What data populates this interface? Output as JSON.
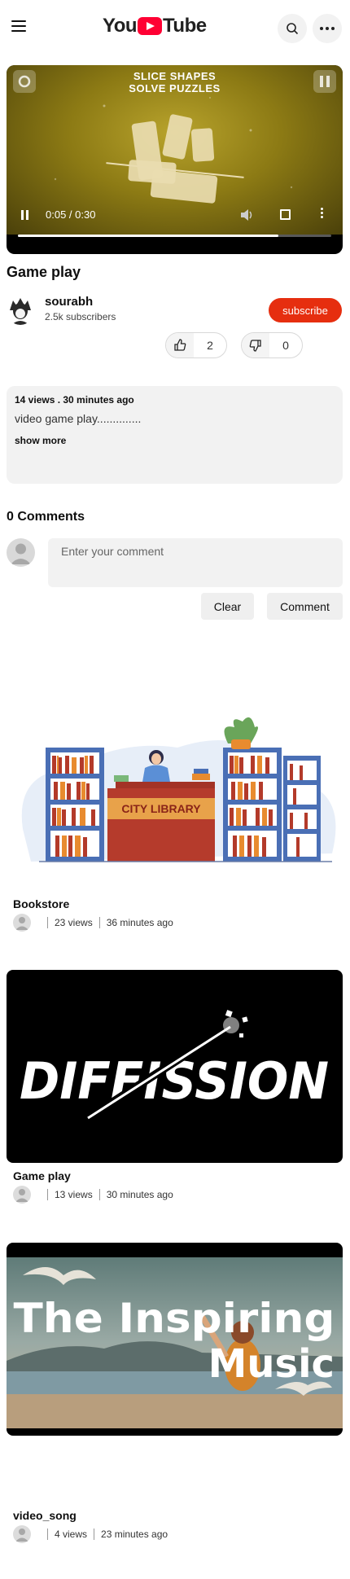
{
  "header": {
    "logo_left": "You",
    "logo_right": "Tube"
  },
  "player": {
    "game_title_line1": "SLICE SHAPES",
    "game_title_line2": "SOLVE PUZZLES",
    "time": "0:05 / 0:30",
    "progress_fraction": 0.83
  },
  "video": {
    "title": "Game play",
    "channel_name": "sourabh",
    "subscribers": "2.5k subscribers",
    "subscribe_label": "subscribe",
    "likes": "2",
    "dislikes": "0"
  },
  "description": {
    "meta": "14 views . 30 minutes ago",
    "text": "video game play..............",
    "show_more": "show more"
  },
  "comments": {
    "heading": "0 Comments",
    "placeholder": "Enter your comment",
    "clear_label": "Clear",
    "comment_label": "Comment"
  },
  "related": [
    {
      "title": "Bookstore",
      "views": "23 views",
      "time": "36 minutes ago",
      "thumb_text": "CITY LIBRARY"
    },
    {
      "title": "Game play",
      "views": "13 views",
      "time": "30 minutes ago",
      "thumb_text": "DIFFISSION"
    },
    {
      "title": "video_song",
      "views": "4 views",
      "time": "23 minutes ago",
      "thumb_text_1": "The Inspiring",
      "thumb_text_2": "Music"
    }
  ],
  "colors": {
    "brand_red": "#ff0033",
    "subscribe_red": "#e62e0f"
  }
}
